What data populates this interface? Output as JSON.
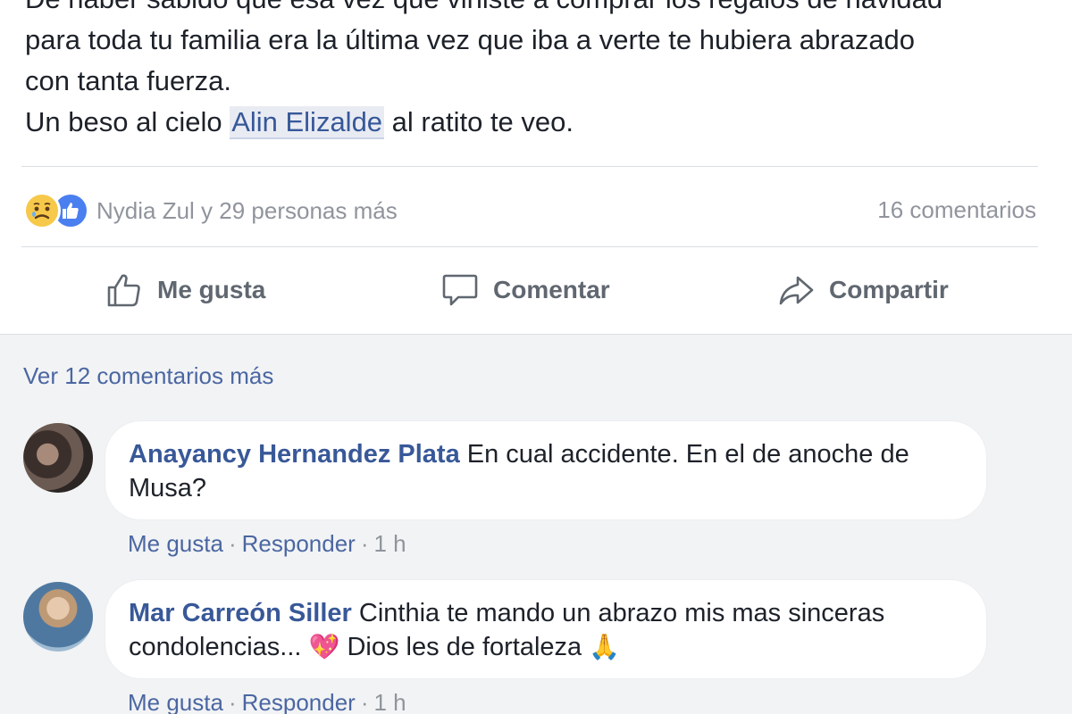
{
  "post": {
    "lines": [
      "De haber sabido que esa vez que viniste a comprar los regalos de navidad",
      "para toda tu familia era la última vez que iba a verte te hubiera abrazado",
      "con tanta fuerza."
    ],
    "last_line_before": "Un beso al cielo ",
    "mention": "Alin Elizalde",
    "last_line_after": " al ratito te veo."
  },
  "reactions": {
    "icons": [
      "sad-icon",
      "like-icon"
    ],
    "colors": {
      "sad": "#f7c94a",
      "like": "#4a7ff0"
    },
    "names": "Nydia Zul y 29 personas más",
    "comments_count": "16 comentarios"
  },
  "actions": {
    "like": "Me gusta",
    "comment": "Comentar",
    "share": "Compartir"
  },
  "more_comments": "Ver 12 comentarios más",
  "comments": [
    {
      "author": "Anayancy Hernandez Plata",
      "text": " En cual accidente. En el de anoche de Musa?",
      "like": "Me gusta",
      "reply": "Responder",
      "time": "1 h"
    },
    {
      "author": "Mar Carreón Siller",
      "text_before": " Cinthia te mando un abrazo mis mas sinceras condolencias... ",
      "heart": "💖",
      "text_middle": " Dios les de fortaleza ",
      "pray": "🙏",
      "like": "Me gusta",
      "reply": "Responder",
      "time": "1 h"
    }
  ],
  "separator": "·"
}
